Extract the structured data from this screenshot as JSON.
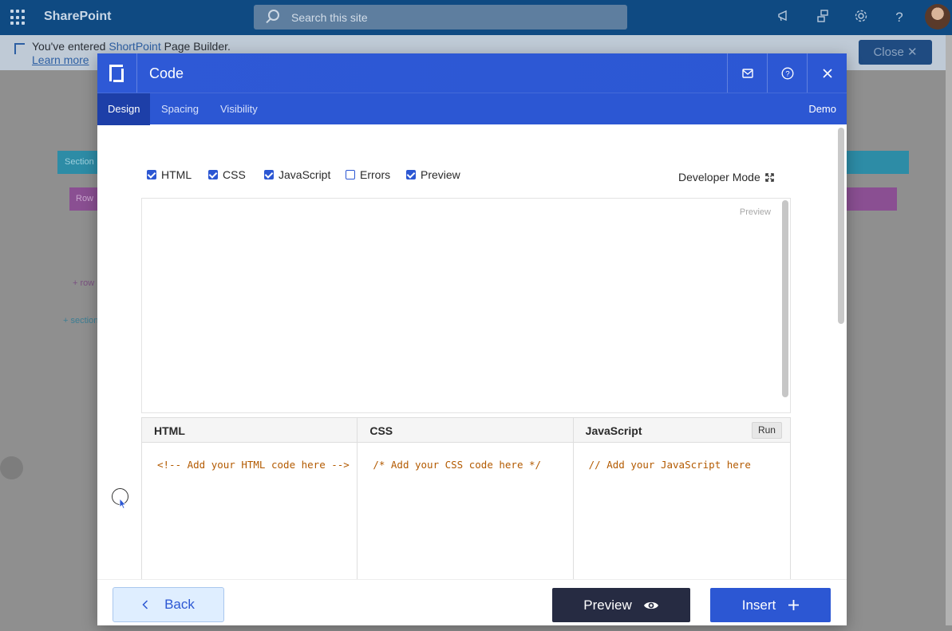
{
  "sharepoint": {
    "brand": "SharePoint",
    "search_placeholder": "Search this site",
    "banner_prefix": "You've entered ",
    "banner_accent": "ShortPoint",
    "banner_suffix": " Page Builder.",
    "banner_link": "Learn more",
    "close_label": "Close",
    "section_label": "Section",
    "row_label": "Row",
    "add_row_label": "+ row",
    "add_section_label": "+ section",
    "icons": [
      "waffle-icon",
      "megaphone-icon",
      "share-icon",
      "gear-icon",
      "help-icon",
      "avatar"
    ]
  },
  "modal": {
    "title": "Code",
    "tabs": [
      {
        "label": "Design",
        "active": true
      },
      {
        "label": "Spacing",
        "active": false
      },
      {
        "label": "Visibility",
        "active": false
      }
    ],
    "demo_label": "Demo",
    "options": [
      {
        "label": "HTML",
        "checked": true
      },
      {
        "label": "CSS",
        "checked": true
      },
      {
        "label": "JavaScript",
        "checked": true
      },
      {
        "label": "Errors",
        "checked": false
      },
      {
        "label": "Preview",
        "checked": true
      }
    ],
    "developer_mode_label": "Developer Mode",
    "preview_label": "Preview",
    "editors": [
      {
        "title": "HTML",
        "code": "<!-- Add your HTML code here -->"
      },
      {
        "title": "CSS",
        "code": "/* Add your CSS code here */"
      },
      {
        "title": "JavaScript",
        "code": "// Add your JavaScript here"
      }
    ],
    "run_label": "Run",
    "footer": {
      "back_label": "Back",
      "preview_label": "Preview",
      "insert_label": "Insert"
    }
  },
  "colors": {
    "accent": "#2c57d3",
    "tab_active": "#1d3fa8",
    "preview_button": "#262b42",
    "code_text": "#b35a00"
  }
}
